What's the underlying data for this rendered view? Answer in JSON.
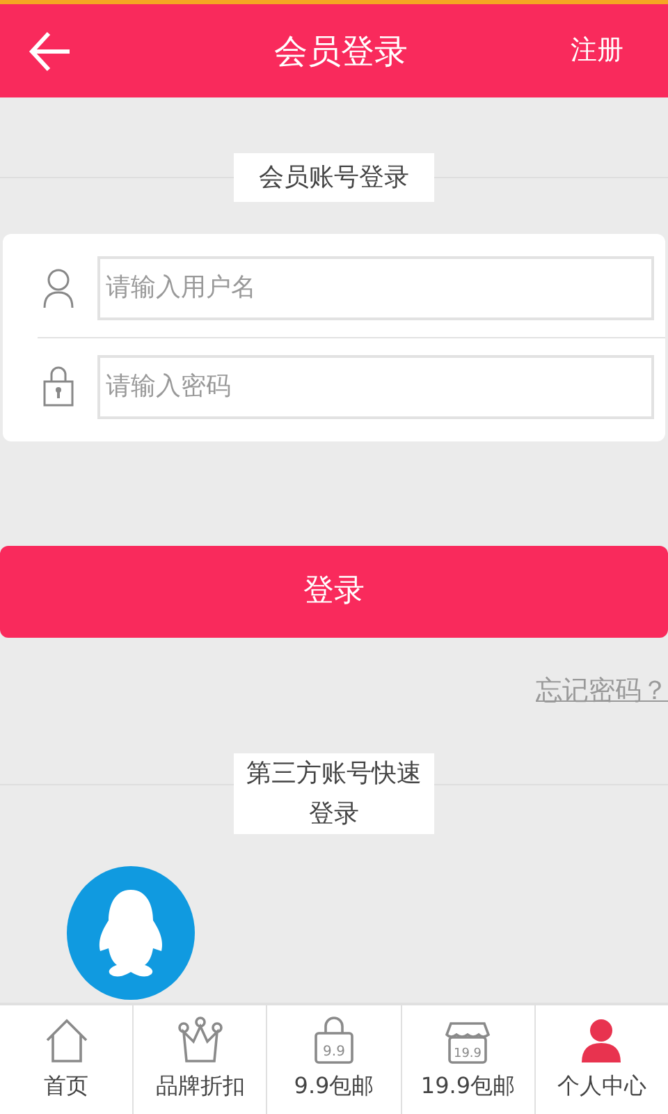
{
  "header": {
    "title": "会员登录",
    "action": "注册"
  },
  "account_section": {
    "title": "会员账号登录"
  },
  "form": {
    "username": {
      "placeholder": "请输入用户名"
    },
    "password": {
      "placeholder": "请输入密码"
    }
  },
  "login_button": "登录",
  "forgot_link": "忘记密码？",
  "third_party": {
    "title": "第三方账号快速登录"
  },
  "tabs": [
    {
      "label": "首页",
      "kind": "home",
      "selected": false
    },
    {
      "label": "品牌折扣",
      "kind": "crown",
      "selected": false
    },
    {
      "label": "9.9包邮",
      "kind": "bag",
      "icon_text": "9.9",
      "selected": false
    },
    {
      "label": "19.9包邮",
      "kind": "shop",
      "icon_text": "19.9",
      "selected": false
    },
    {
      "label": "个人中心",
      "kind": "person",
      "selected": true
    }
  ]
}
